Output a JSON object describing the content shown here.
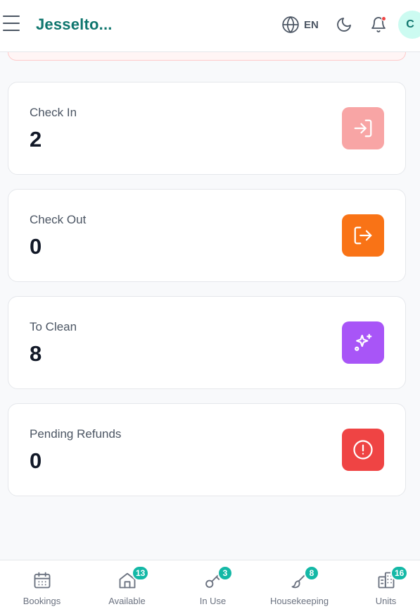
{
  "header": {
    "brand": "Jesselto...",
    "language": "EN",
    "avatar_initial": "C",
    "icons": [
      "menu-icon",
      "globe-icon",
      "moon-icon",
      "bell-icon"
    ]
  },
  "stats": [
    {
      "label": "Check In",
      "value": "2",
      "icon": "login-icon",
      "color": "#f8a5a5"
    },
    {
      "label": "Check Out",
      "value": "0",
      "icon": "logout-icon",
      "color": "#f97316"
    },
    {
      "label": "To Clean",
      "value": "8",
      "icon": "sparkles-icon",
      "color": "#a855f7"
    },
    {
      "label": "Pending Refunds",
      "value": "0",
      "icon": "alert-circle-icon",
      "color": "#ef4444"
    }
  ],
  "bottom_nav": [
    {
      "label": "Bookings",
      "icon": "calendar-icon",
      "badge": ""
    },
    {
      "label": "Available",
      "icon": "home-icon",
      "badge": "13"
    },
    {
      "label": "In Use",
      "icon": "key-icon",
      "badge": "3"
    },
    {
      "label": "Housekeeping",
      "icon": "brush-icon",
      "badge": "8"
    },
    {
      "label": "Units",
      "icon": "building-icon",
      "badge": "16"
    }
  ],
  "colors": {
    "brand": "#0f766e",
    "badge": "#14b8a6",
    "notification_dot": "#ef4444"
  }
}
